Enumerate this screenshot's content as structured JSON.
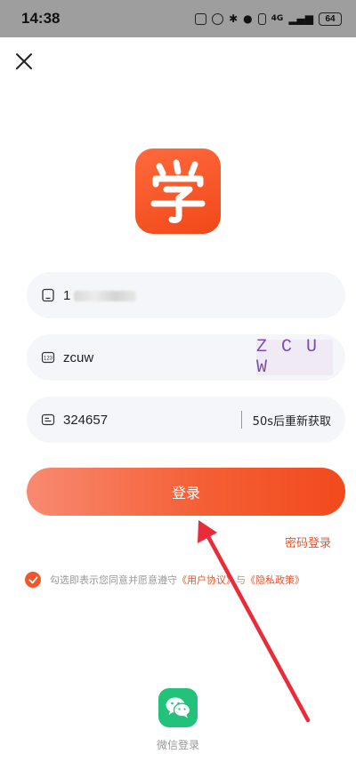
{
  "status_bar": {
    "time": "14:38",
    "battery": "64",
    "network": "4G"
  },
  "phone_field": {
    "value": "1"
  },
  "captcha_field": {
    "value": "zcuw",
    "image_text": "Z C U W"
  },
  "code_field": {
    "value": "324657",
    "resend_label": "50s后重新获取"
  },
  "login_button": {
    "label": "登录"
  },
  "password_login": {
    "label": "密码登录"
  },
  "agreement": {
    "prefix": "勾选即表示您同意并愿意遵守",
    "user_agreement": "《用户协议》",
    "conjunction": "与",
    "privacy_policy": "《隐私政策》"
  },
  "wechat_login": {
    "label": "微信登录"
  },
  "colors": {
    "accent": "#f24a1c",
    "wechat": "#22c27a",
    "arrow": "#ea2c3a"
  }
}
